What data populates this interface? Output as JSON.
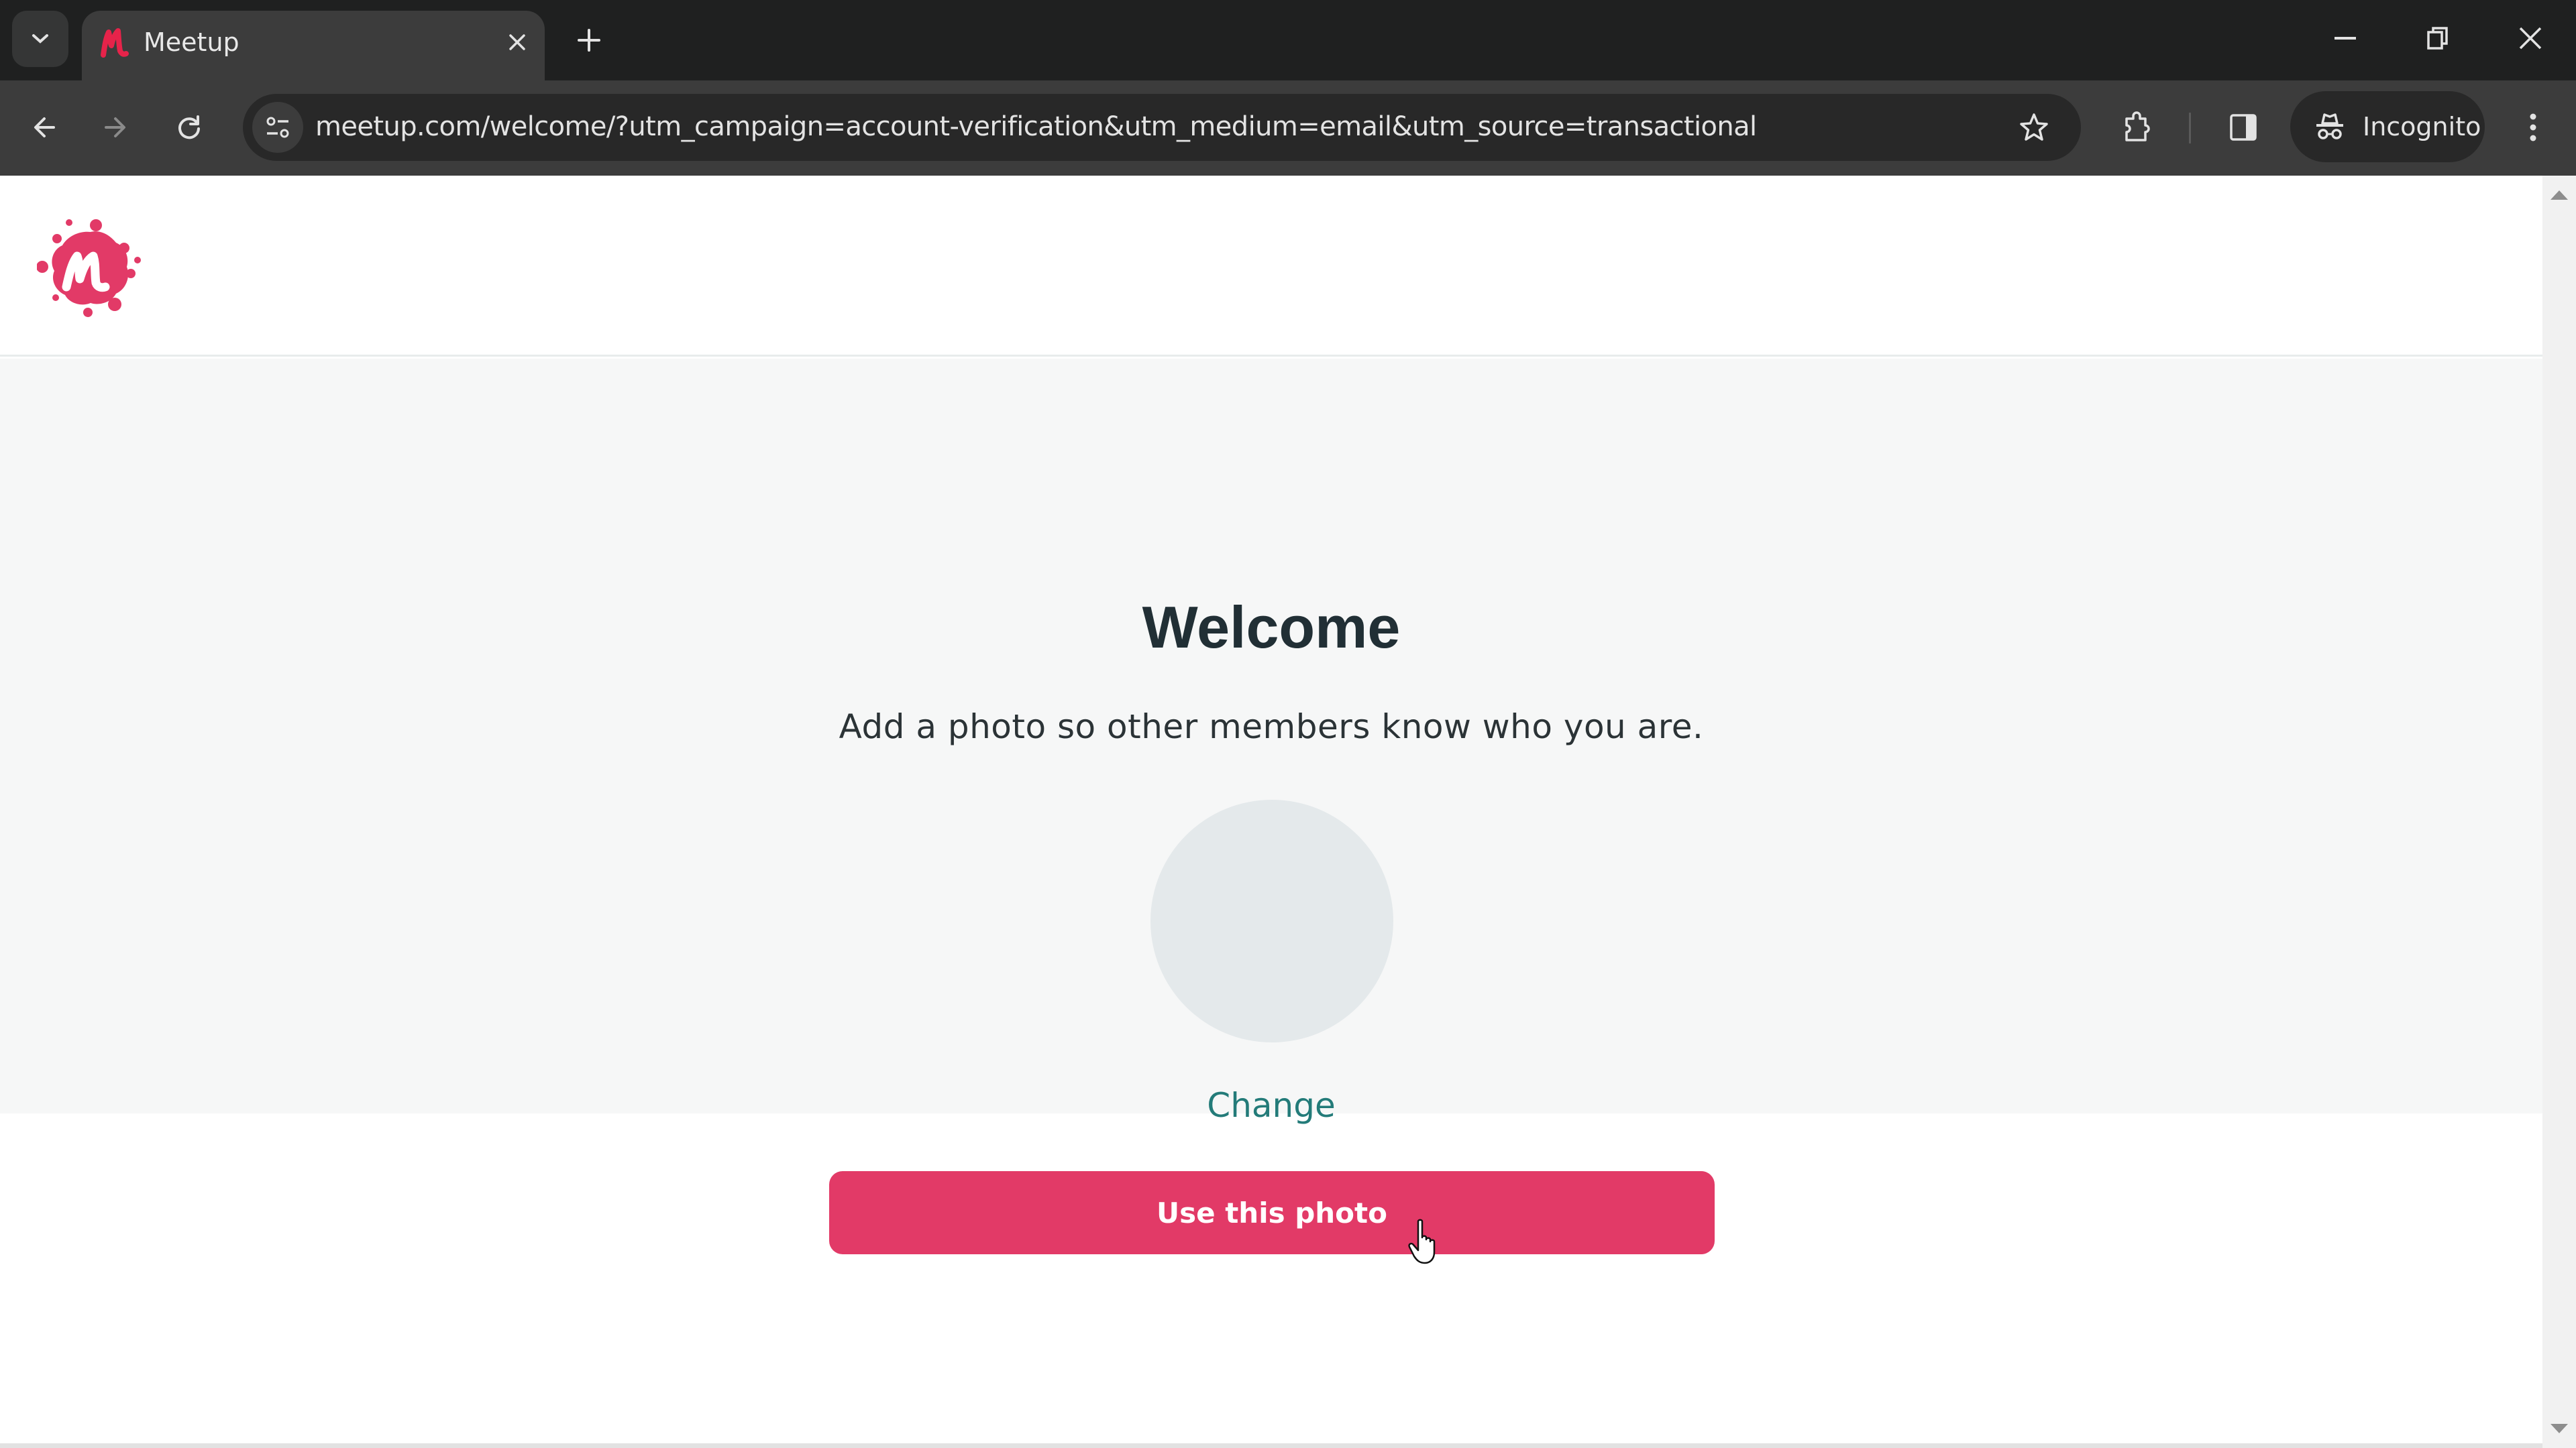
{
  "browser": {
    "tab": {
      "title": "Meetup",
      "favicon": "meetup-favicon"
    },
    "url": "meetup.com/welcome/?utm_campaign=account-verification&utm_medium=email&utm_source=transactional",
    "profile_label": "Incognito",
    "icons": {
      "tab_search": "chevron-down-icon",
      "close_tab": "close-icon",
      "new_tab": "plus-icon",
      "minimize": "minimize-icon",
      "restore": "restore-icon",
      "close_window": "close-icon",
      "back": "arrow-left-icon",
      "forward": "arrow-right-icon",
      "reload": "reload-icon",
      "site_info": "tune-icon",
      "bookmark": "star-icon",
      "extensions": "puzzle-icon",
      "side_panel": "side-panel-icon",
      "incognito": "incognito-icon",
      "menu": "kebab-menu-icon"
    }
  },
  "page": {
    "logo": "meetup-logo",
    "title": "Welcome",
    "subtitle": "Add a photo so other members know who you are.",
    "avatar": "profile-photo-placeholder",
    "change_link": "Change",
    "primary_button": "Use this photo"
  },
  "colors": {
    "brand": "#e23a67",
    "link": "#237b79",
    "heading": "#212f35",
    "section_bg": "#f6f7f7",
    "avatar_bg": "#e4e9eb"
  }
}
